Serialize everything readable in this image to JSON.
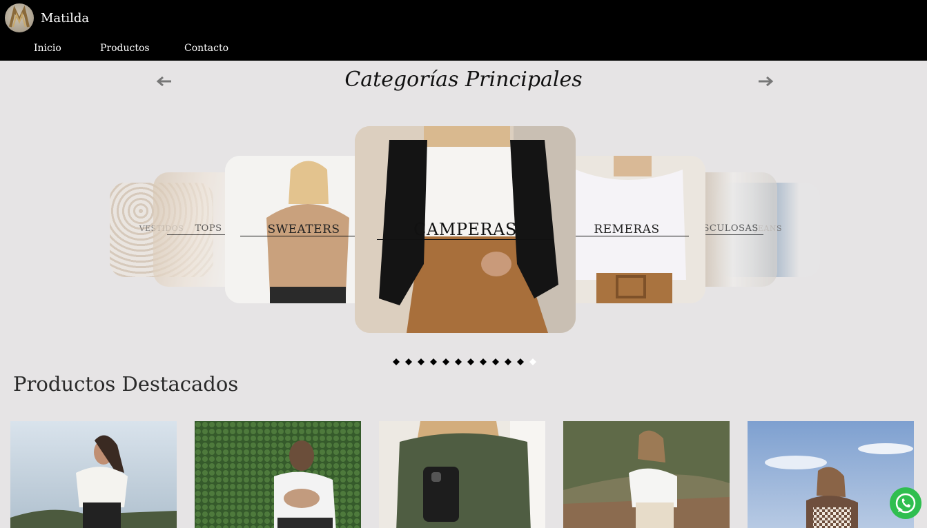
{
  "header": {
    "brand": "Matilda",
    "nav": [
      {
        "label": "Inicio"
      },
      {
        "label": "Productos"
      },
      {
        "label": "Contacto"
      }
    ]
  },
  "carousel": {
    "title": "Categorías Principales",
    "prev_icon": "arrow-left-icon",
    "next_icon": "arrow-right-icon",
    "categories": [
      {
        "label": "VESTIDOS",
        "state": "far"
      },
      {
        "label": "TOPS",
        "state": "near"
      },
      {
        "label": "SWEATERS",
        "state": "side"
      },
      {
        "label": "CAMPERAS",
        "state": "active"
      },
      {
        "label": "REMERAS",
        "state": "side"
      },
      {
        "label": "MUSCULOSAS",
        "state": "near"
      },
      {
        "label": "JEANS",
        "state": "far"
      }
    ],
    "dot_count": 12,
    "active_dot": 12
  },
  "featured": {
    "title": "Productos Destacados",
    "products": [
      {
        "image": "woman-white-sweater-sky"
      },
      {
        "image": "woman-white-top-hedge"
      },
      {
        "image": "woman-green-shirt-mirror-selfie"
      },
      {
        "image": "woman-white-top-forest"
      },
      {
        "image": "woman-knit-vest-sky"
      }
    ]
  },
  "floating": {
    "whatsapp_icon": "whatsapp-icon"
  },
  "colors": {
    "header_bg": "#000000",
    "page_bg": "#e6e4e5",
    "whatsapp": "#2fbe4f"
  }
}
